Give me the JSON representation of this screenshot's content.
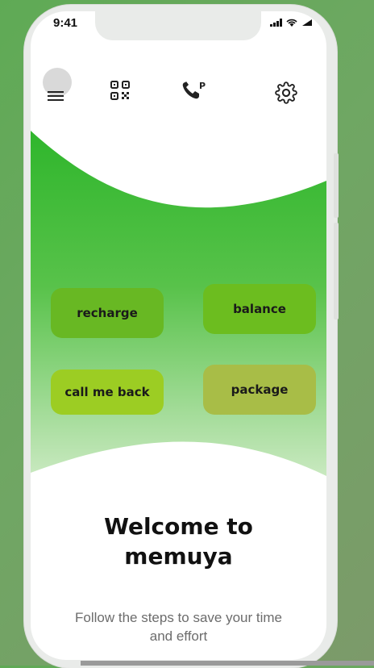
{
  "status_bar": {
    "time": "9:41",
    "icons": [
      "signal-icon",
      "wifi-icon",
      "battery-icon"
    ]
  },
  "top_bar": {
    "icons": [
      "avatar",
      "menu-icon",
      "qr-code-icon",
      "phone-p-icon",
      "settings-icon"
    ],
    "phone_badge": "P"
  },
  "actions": {
    "recharge": "recharge",
    "balance": "balance",
    "call_me_back": "call me back",
    "package": "package"
  },
  "colors": {
    "accent": "#39b83a",
    "recharge_bg": "#68b823",
    "balance_bg": "#6cbd1f",
    "call_me_back_bg": "#9ccd23",
    "package_bg": "#a8bd47"
  },
  "welcome": {
    "line1": "Welcome to",
    "line2": "memuya"
  },
  "subtitle": "Follow the steps to save your time and effort"
}
